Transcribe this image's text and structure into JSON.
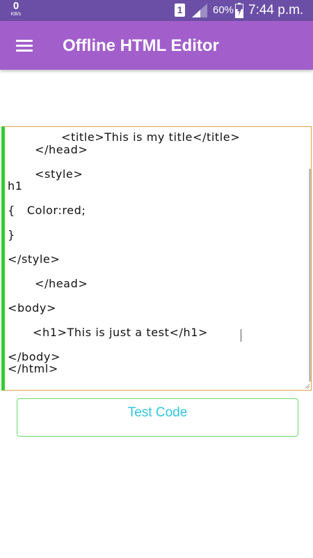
{
  "status_bar": {
    "net_speed_value": "0",
    "net_speed_unit": "KB/s",
    "sim_slot": "1",
    "battery_percent": "60%",
    "time": "7:44 p.m."
  },
  "app_bar": {
    "title": "Offline HTML Editor",
    "menu_icon": "hamburger-menu-icon"
  },
  "editor": {
    "lines": [
      "<title>This is my title</title>",
      "</head>",
      "<style>",
      "h1",
      "{   Color:red;",
      "}",
      "</style>",
      "</head>",
      "<body>",
      "<h1>This is just a test</h1>",
      "</body>",
      "</html>"
    ]
  },
  "test_button": {
    "label": "Test Code"
  },
  "colors": {
    "status_bar": "#6b4fa6",
    "app_bar": "#a25fcb",
    "editor_left_border": "#33cc33",
    "editor_border": "#e0a040",
    "button_border": "#66dd66",
    "button_text": "#2ec6e0"
  }
}
